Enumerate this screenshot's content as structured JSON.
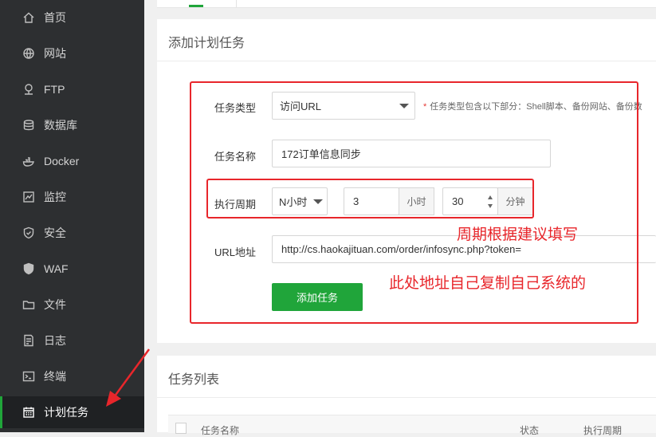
{
  "sidebar": {
    "items": [
      {
        "label": "首页",
        "icon": "home-icon"
      },
      {
        "label": "网站",
        "icon": "globe-icon"
      },
      {
        "label": "FTP",
        "icon": "ftp-icon"
      },
      {
        "label": "数据库",
        "icon": "database-icon"
      },
      {
        "label": "Docker",
        "icon": "docker-icon"
      },
      {
        "label": "监控",
        "icon": "monitor-icon"
      },
      {
        "label": "安全",
        "icon": "shield-icon"
      },
      {
        "label": "WAF",
        "icon": "waf-shield-icon"
      },
      {
        "label": "文件",
        "icon": "folder-icon"
      },
      {
        "label": "日志",
        "icon": "log-icon"
      },
      {
        "label": "终端",
        "icon": "terminal-icon"
      },
      {
        "label": "计划任务",
        "icon": "calendar-icon",
        "active": true
      }
    ]
  },
  "form": {
    "title": "添加计划任务",
    "task_type_label": "任务类型",
    "task_type_value": "访问URL",
    "task_type_hint": "任务类型包含以下部分：Shell脚本、备份网站、备份数",
    "task_name_label": "任务名称",
    "task_name_value": "172订单信息同步",
    "period_label": "执行周期",
    "period_type_value": "N小时",
    "hours_value": "3",
    "hours_unit": "小时",
    "minutes_value": "30",
    "minutes_unit": "分钟",
    "url_label": "URL地址",
    "url_value": "http://cs.haokajituan.com/order/infosync.php?token=",
    "submit_label": "添加任务"
  },
  "annotations": {
    "period_note": "周期根据建议填写",
    "url_note": "此处地址自己复制自己系统的"
  },
  "task_list": {
    "title": "任务列表",
    "columns": [
      "任务名称",
      "状态",
      "执行周期"
    ]
  },
  "colors": {
    "accent": "#20a53a",
    "annotation_red": "#e8262b",
    "sidebar_bg": "#2d2f31"
  }
}
